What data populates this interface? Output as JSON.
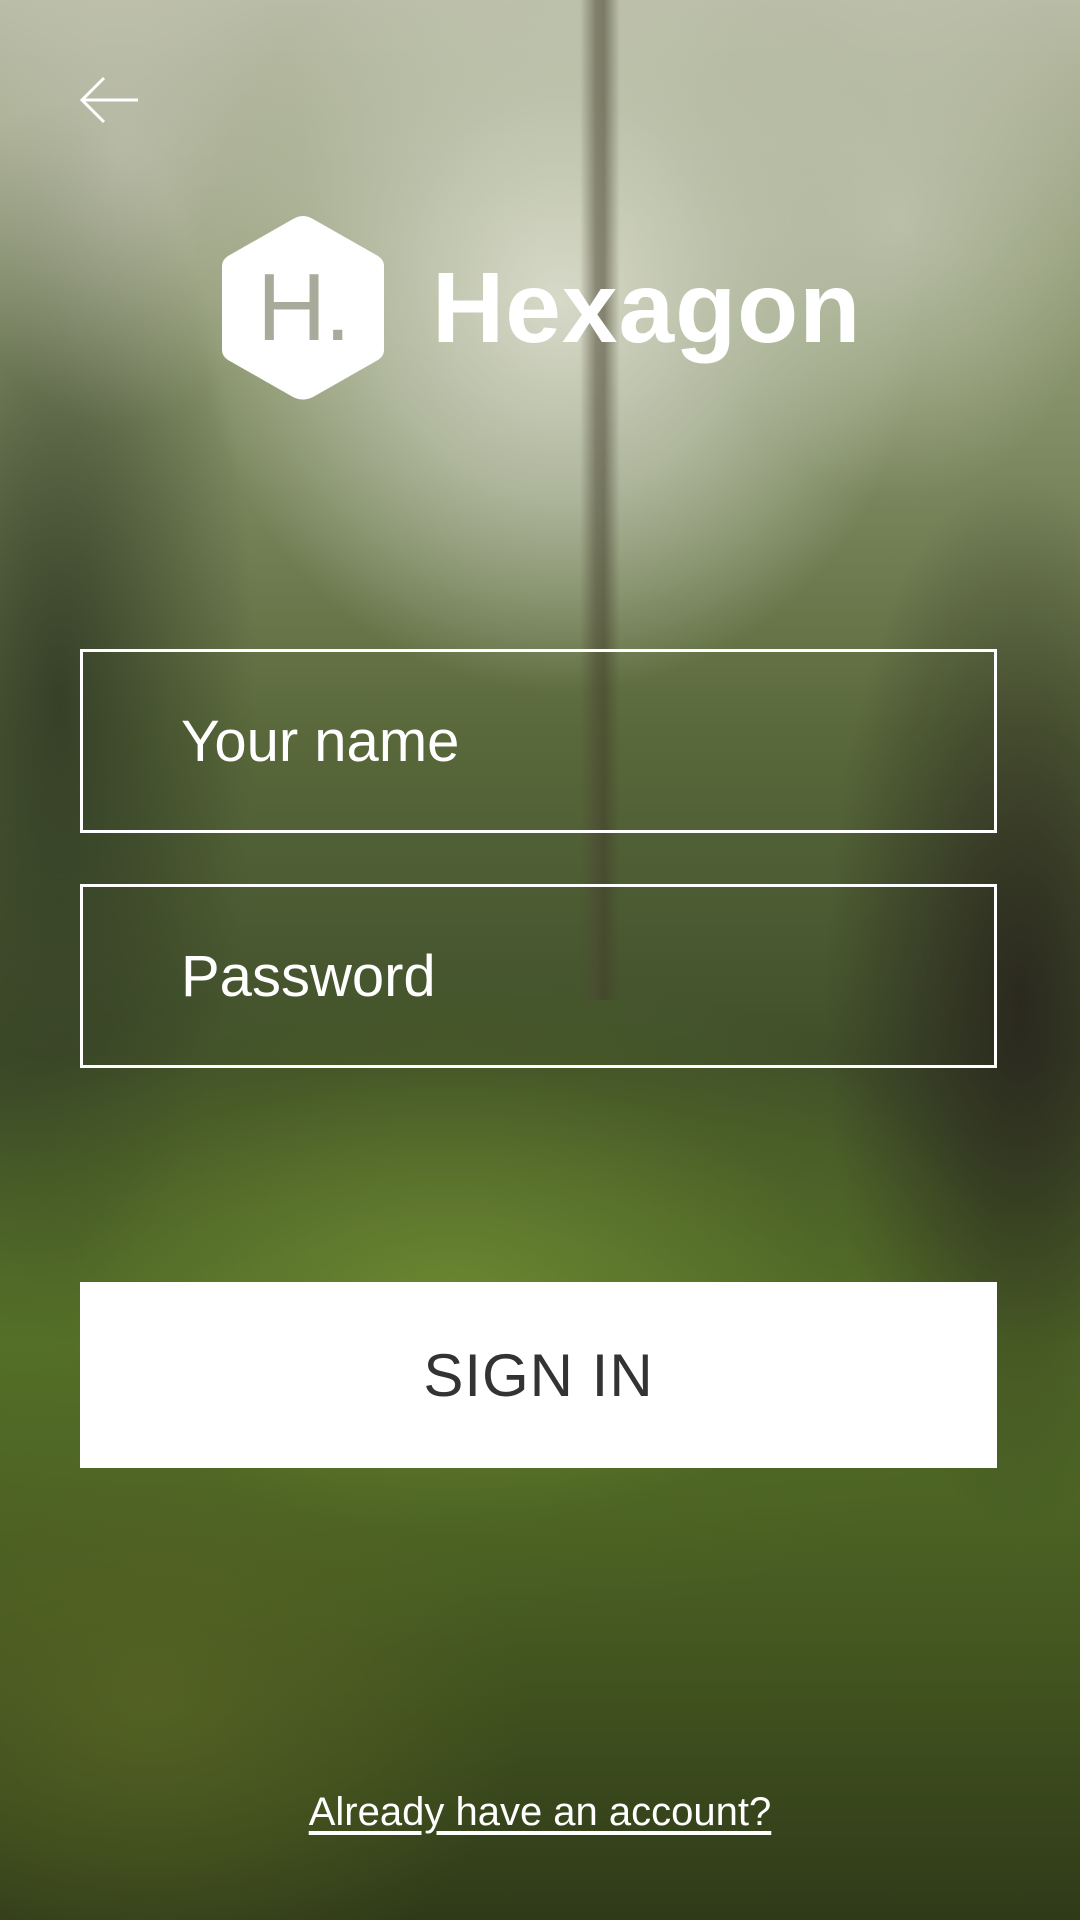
{
  "header": {
    "back_icon": "arrow-left-icon"
  },
  "logo": {
    "mark_letter": "H.",
    "brand_name": "Hexagon",
    "mark_icon": "hexagon-icon"
  },
  "form": {
    "name_placeholder": "Your name",
    "name_value": "",
    "password_placeholder": "Password",
    "password_value": "",
    "signin_label": "SIGN IN"
  },
  "footer": {
    "account_link": "Already have an account?"
  },
  "colors": {
    "text": "#ffffff",
    "button_bg": "#ffffff",
    "button_text": "#333333",
    "logo_letter": "#a8ab99"
  }
}
